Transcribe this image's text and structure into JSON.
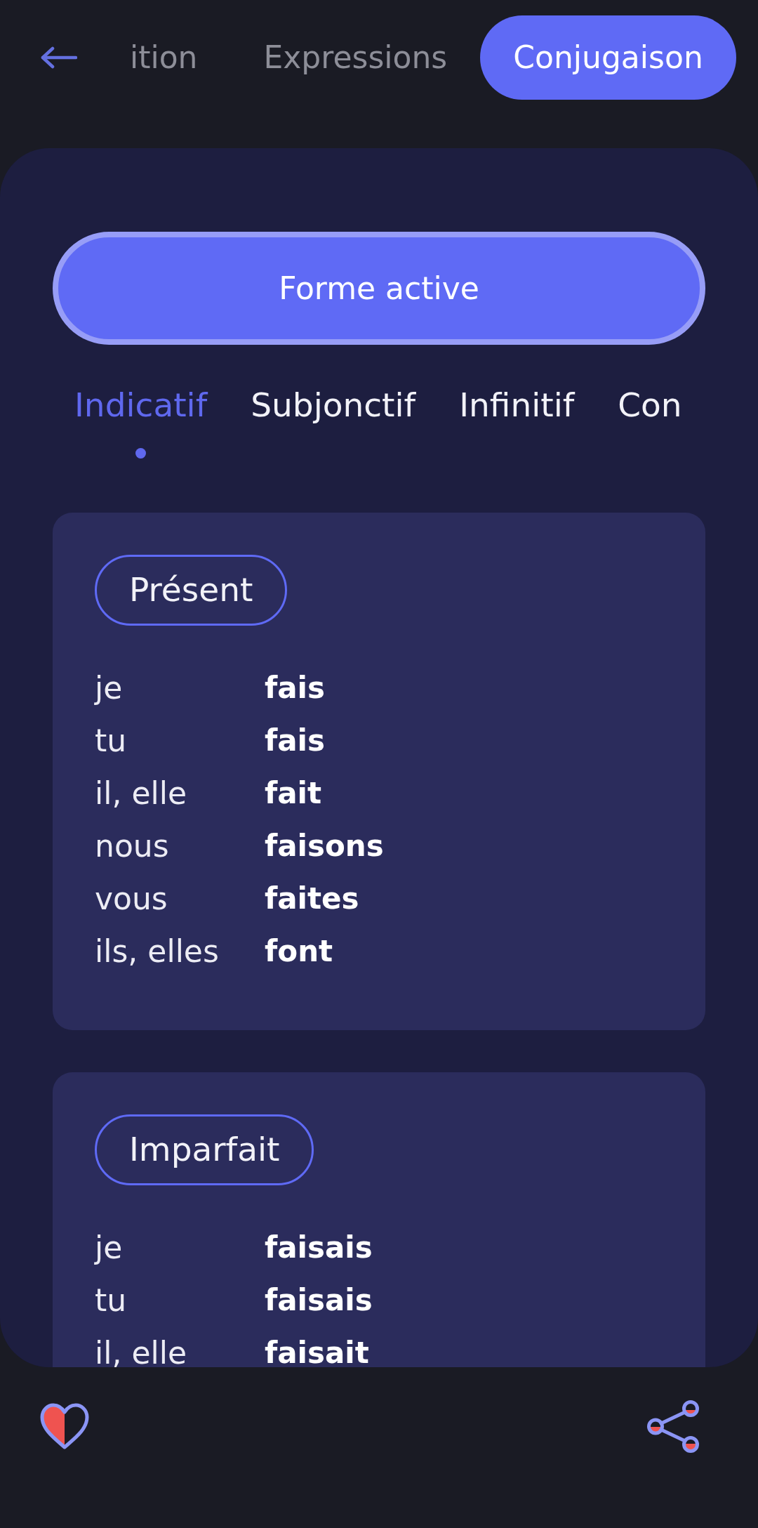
{
  "section_tabs": [
    {
      "label": "ition",
      "selected": false
    },
    {
      "label": "Expressions",
      "selected": false
    },
    {
      "label": "Conjugaison",
      "selected": true
    }
  ],
  "voice_button": {
    "label": "Forme active"
  },
  "mood_tabs": [
    {
      "label": "Indicatif",
      "selected": true
    },
    {
      "label": "Subjonctif",
      "selected": false
    },
    {
      "label": "Infinitif",
      "selected": false
    },
    {
      "label": "Con",
      "selected": false
    }
  ],
  "tenses": [
    {
      "title": "Présent",
      "rows": [
        {
          "person": "je",
          "form": "fais"
        },
        {
          "person": "tu",
          "form": "fais"
        },
        {
          "person": "il, elle",
          "form": "fait"
        },
        {
          "person": "nous",
          "form": "faisons"
        },
        {
          "person": "vous",
          "form": "faites"
        },
        {
          "person": "ils, elles",
          "form": "font"
        }
      ]
    },
    {
      "title": "Imparfait",
      "rows": [
        {
          "person": "je",
          "form": "faisais"
        },
        {
          "person": "tu",
          "form": "faisais"
        },
        {
          "person": "il, elle",
          "form": "faisait"
        }
      ]
    }
  ]
}
